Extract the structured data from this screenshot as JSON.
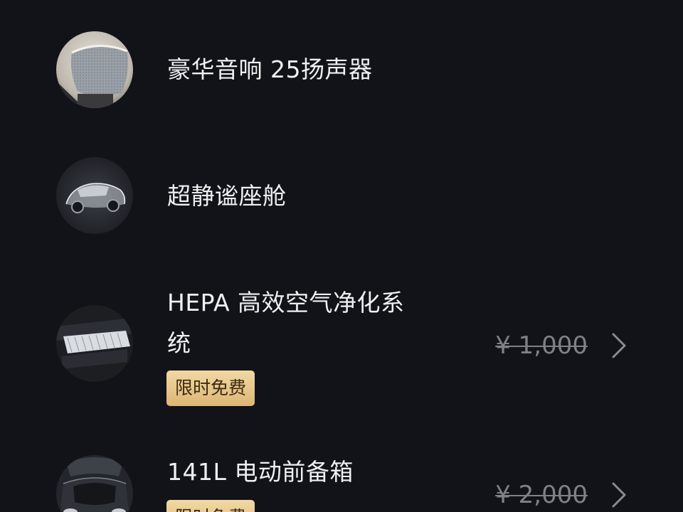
{
  "features": [
    {
      "title": "豪华音响 25扬声器",
      "icon": "speaker-thumbnail"
    },
    {
      "title": "超静谧座舱",
      "icon": "car-cabin-thumbnail"
    },
    {
      "title_line1": "HEPA 高效空气净化系",
      "title_line2": "统",
      "badge": "限时免费",
      "price": "¥ 1,000",
      "icon": "air-filter-thumbnail"
    },
    {
      "title": "141L 电动前备箱",
      "badge": "限时免费",
      "price": "¥ 2,000",
      "icon": "frunk-thumbnail"
    }
  ],
  "colors": {
    "background": "#121318",
    "text": "#eef0f2",
    "price": "#7f8186",
    "badge_gold": "#e6c284",
    "badge_text": "#3c2a10"
  }
}
